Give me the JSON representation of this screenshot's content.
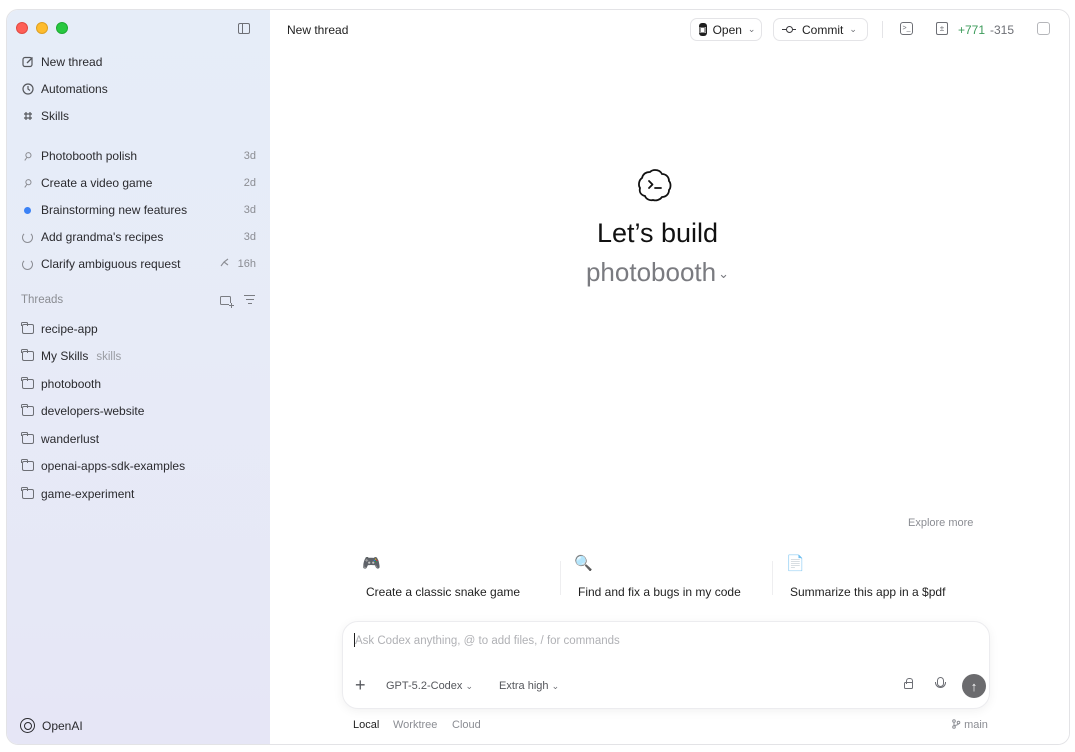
{
  "sidebar": {
    "nav": [
      {
        "label": "New thread",
        "icon": "edit-icon"
      },
      {
        "label": "Automations",
        "icon": "clock-icon"
      },
      {
        "label": "Skills",
        "icon": "skills-icon"
      }
    ],
    "recent": [
      {
        "label": "Photobooth polish",
        "age": "3d",
        "icon": "pin-icon"
      },
      {
        "label": "Create a video game",
        "age": "2d",
        "icon": "pin-icon"
      },
      {
        "label": "Brainstorming new features",
        "age": "3d",
        "icon": "unread-dot-icon"
      },
      {
        "label": "Add grandma's recipes",
        "age": "3d",
        "icon": "loading-icon"
      },
      {
        "label": "Clarify ambiguous request",
        "age": "16h",
        "icon": "loading-icon",
        "extra": "fork-icon"
      }
    ],
    "threads_label": "Threads",
    "projects": [
      {
        "label": "recipe-app",
        "sub": ""
      },
      {
        "label": "My Skills",
        "sub": "skills"
      },
      {
        "label": "photobooth",
        "sub": ""
      },
      {
        "label": "developers-website",
        "sub": ""
      },
      {
        "label": "wanderlust",
        "sub": ""
      },
      {
        "label": "openai-apps-sdk-examples",
        "sub": ""
      },
      {
        "label": "game-experiment",
        "sub": ""
      }
    ],
    "org": "OpenAI"
  },
  "header": {
    "title": "New thread",
    "open_label": "Open",
    "commit_label": "Commit",
    "diff_added": "+771",
    "diff_removed": "-315"
  },
  "hero": {
    "title": "Let’s build",
    "project": "photobooth"
  },
  "explore_label": "Explore more",
  "suggestions": [
    {
      "emoji": "🎮",
      "text": "Create a classic snake game"
    },
    {
      "emoji": "🔍",
      "text": "Find and fix a bugs in my code"
    },
    {
      "emoji": "📄",
      "text": "Summarize this app in a $pdf"
    }
  ],
  "composer": {
    "placeholder": "Ask Codex anything, @ to add files, / for commands",
    "model": "GPT-5.2-Codex",
    "effort": "Extra high"
  },
  "modes": [
    "Local",
    "Worktree",
    "Cloud"
  ],
  "active_mode": "Local",
  "branch": "main",
  "colors": {
    "sidebar_bg": "#e6edf8",
    "diff_added": "#3c9b5a",
    "unread_dot": "#3b82f6",
    "send_button": "#6b6b6e"
  }
}
